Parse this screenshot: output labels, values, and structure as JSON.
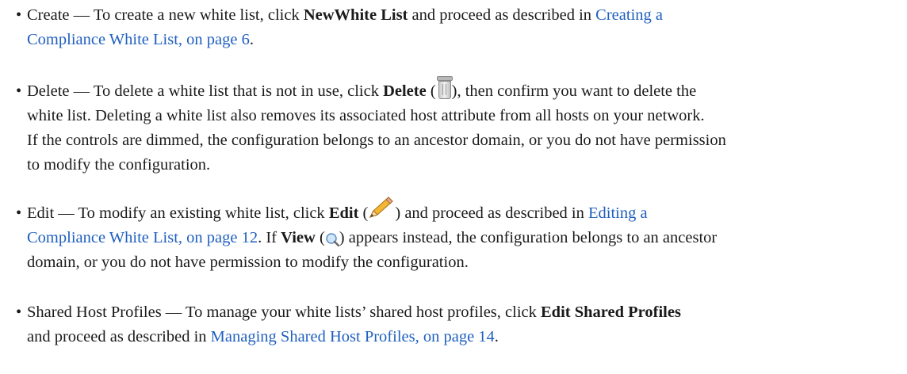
{
  "items": [
    {
      "lead": "Create — To create a new white list, click ",
      "bold": "NewWhite List",
      "after": " and proceed as described in ",
      "link_line1": "Creating a",
      "link_line2": "Compliance White List, on page 6",
      "end": "."
    },
    {
      "lead": "Delete — To delete a white list that is not in use, click ",
      "bold": "Delete",
      "paren_open": " (",
      "paren_close": "), then confirm you want to delete the",
      "line2": "white list. Deleting a white list also removes its associated host attribute from all hosts on your network.",
      "line3": "If the controls are dimmed, the configuration belongs to an ancestor domain, or you do not have permission",
      "line4": "to modify the configuration."
    },
    {
      "lead": "Edit — To modify an existing white list, click ",
      "bold": "Edit",
      "paren_open": " (",
      "paren_close": ") and proceed as described in ",
      "link_line1": "Editing a",
      "link_line2": "Compliance White List, on page 12",
      "mid": ". If ",
      "bold2": "View",
      "paren2_open": " (",
      "paren2_close": ") appears instead, the configuration belongs to an ancestor",
      "line3": "domain, or you do not have permission to modify the configuration."
    },
    {
      "lead": "Shared Host Profiles — To manage your white lists’ shared host profiles, click ",
      "bold": "Edit Shared Profiles",
      "line2_pre": "and proceed as described in ",
      "link": "Managing Shared Host Profiles, on page 14",
      "end": "."
    }
  ],
  "icons": {
    "delete": "trash-icon",
    "edit": "pencil-icon",
    "view": "magnifier-icon"
  },
  "colors": {
    "link": "#1f5fbf",
    "text": "#1a1a1a"
  }
}
